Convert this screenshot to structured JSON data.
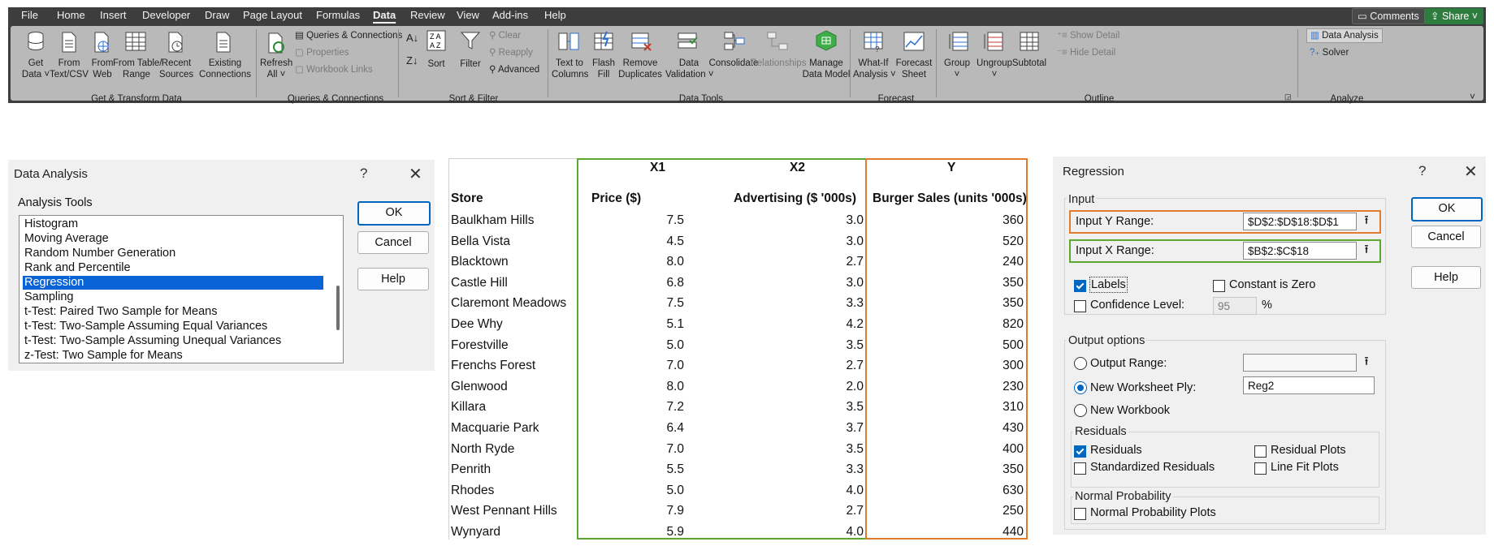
{
  "ribbon": {
    "tabs": [
      "File",
      "Home",
      "Insert",
      "Developer",
      "Draw",
      "Page Layout",
      "Formulas",
      "Data",
      "Review",
      "View",
      "Add-ins",
      "Help"
    ],
    "active_tab": "Data",
    "comments": "Comments",
    "share": "Share",
    "buttons": {
      "get_data": [
        "Get",
        "Data ˅"
      ],
      "from_text": [
        "From",
        "Text/CSV"
      ],
      "from_web": [
        "From",
        "Web"
      ],
      "from_table": [
        "From Table/",
        "Range"
      ],
      "recent_sources": [
        "Recent",
        "Sources"
      ],
      "existing_connections": [
        "Existing",
        "Connections"
      ],
      "refresh_all": [
        "Refresh",
        "All ˅"
      ],
      "queries_connections": "Queries & Connections",
      "properties": "Properties",
      "workbook_links": "Workbook Links",
      "sort": "Sort",
      "filter": "Filter",
      "clear": "Clear",
      "reapply": "Reapply",
      "advanced": "Advanced",
      "text_to_columns": [
        "Text to",
        "Columns"
      ],
      "flash_fill": [
        "Flash",
        "Fill"
      ],
      "remove_duplicates": [
        "Remove",
        "Duplicates"
      ],
      "data_validation": [
        "Data",
        "Validation ˅"
      ],
      "consolidate": "Consolidate",
      "relationships": "Relationships",
      "manage_data_model": [
        "Manage",
        "Data Model"
      ],
      "what_if": [
        "What-If",
        "Analysis ˅"
      ],
      "forecast_sheet": [
        "Forecast",
        "Sheet"
      ],
      "group": [
        "Group",
        "˅"
      ],
      "ungroup": [
        "Ungroup",
        "˅"
      ],
      "subtotal": "Subtotal",
      "show_detail": "Show Detail",
      "hide_detail": "Hide Detail",
      "data_analysis": "Data Analysis",
      "solver": "Solver"
    },
    "groups": [
      "Get & Transform Data",
      "Queries & Connections",
      "Sort & Filter",
      "Data Tools",
      "Forecast",
      "Outline",
      "Analyze"
    ]
  },
  "data_analysis": {
    "title": "Data Analysis",
    "help_glyph": "?",
    "close_glyph": "✕",
    "tools_label": "Analysis Tools",
    "items": [
      "Histogram",
      "Moving Average",
      "Random Number Generation",
      "Rank and Percentile",
      "Regression",
      "Sampling",
      "t-Test: Paired Two Sample for Means",
      "t-Test: Two-Sample Assuming Equal Variances",
      "t-Test: Two-Sample Assuming Unequal Variances",
      "z-Test: Two Sample for Means"
    ],
    "selected": "Regression",
    "ok": "OK",
    "cancel": "Cancel",
    "help": "Help"
  },
  "sheet": {
    "group_headers": {
      "x1": "X1",
      "x2": "X2",
      "y": "Y"
    },
    "columns": [
      "Store",
      "Price ($)",
      "Advertising ($ '000s)",
      "Burger Sales (units '000s)"
    ],
    "rows": [
      [
        "Baulkham Hills",
        "7.5",
        "3.0",
        "360"
      ],
      [
        "Bella Vista",
        "4.5",
        "3.0",
        "520"
      ],
      [
        "Blacktown",
        "8.0",
        "2.7",
        "240"
      ],
      [
        "Castle Hill",
        "6.8",
        "3.0",
        "350"
      ],
      [
        "Claremont Meadows",
        "7.5",
        "3.3",
        "350"
      ],
      [
        "Dee Why",
        "5.1",
        "4.2",
        "820"
      ],
      [
        "Forestville",
        "5.0",
        "3.5",
        "500"
      ],
      [
        "Frenchs Forest",
        "7.0",
        "2.7",
        "300"
      ],
      [
        "Glenwood",
        "8.0",
        "2.0",
        "230"
      ],
      [
        "Killara",
        "7.2",
        "3.5",
        "310"
      ],
      [
        "Macquarie Park",
        "6.4",
        "3.7",
        "430"
      ],
      [
        "North Ryde",
        "7.0",
        "3.5",
        "400"
      ],
      [
        "Penrith",
        "5.5",
        "3.3",
        "350"
      ],
      [
        "Rhodes",
        "5.0",
        "4.0",
        "630"
      ],
      [
        "West Pennant Hills",
        "7.9",
        "2.7",
        "250"
      ],
      [
        "Wynyard",
        "5.9",
        "4.0",
        "440"
      ]
    ],
    "colors": {
      "x_box": "#5aa832",
      "y_box": "#e07b30"
    }
  },
  "regression": {
    "title": "Regression",
    "help_glyph": "?",
    "close_glyph": "✕",
    "input_label": "Input",
    "input_y_label": "Input Y Range:",
    "input_y_value": "$D$2:$D$18:$D$1",
    "input_x_label": "Input X Range:",
    "input_x_value": "$B$2:$C$18",
    "labels": "Labels",
    "labels_checked": true,
    "constant_zero": "Constant is Zero",
    "confidence": "Confidence Level:",
    "confidence_value": "95",
    "percent": "%",
    "output_label": "Output options",
    "output_range": "Output Range:",
    "new_ply": "New Worksheet Ply:",
    "new_ply_value": "Reg2",
    "new_workbook": "New Workbook",
    "residuals_label": "Residuals",
    "residuals": "Residuals",
    "std_residuals": "Standardized Residuals",
    "residual_plots": "Residual Plots",
    "line_fit": "Line Fit Plots",
    "normal_label": "Normal Probability",
    "normal_plots": "Normal Probability Plots",
    "ok": "OK",
    "cancel": "Cancel",
    "help": "Help",
    "upload_glyph": "⭱",
    "colors": {
      "y_box": "#e07b30",
      "x_box": "#5aa832",
      "accent": "#0067c0"
    }
  }
}
